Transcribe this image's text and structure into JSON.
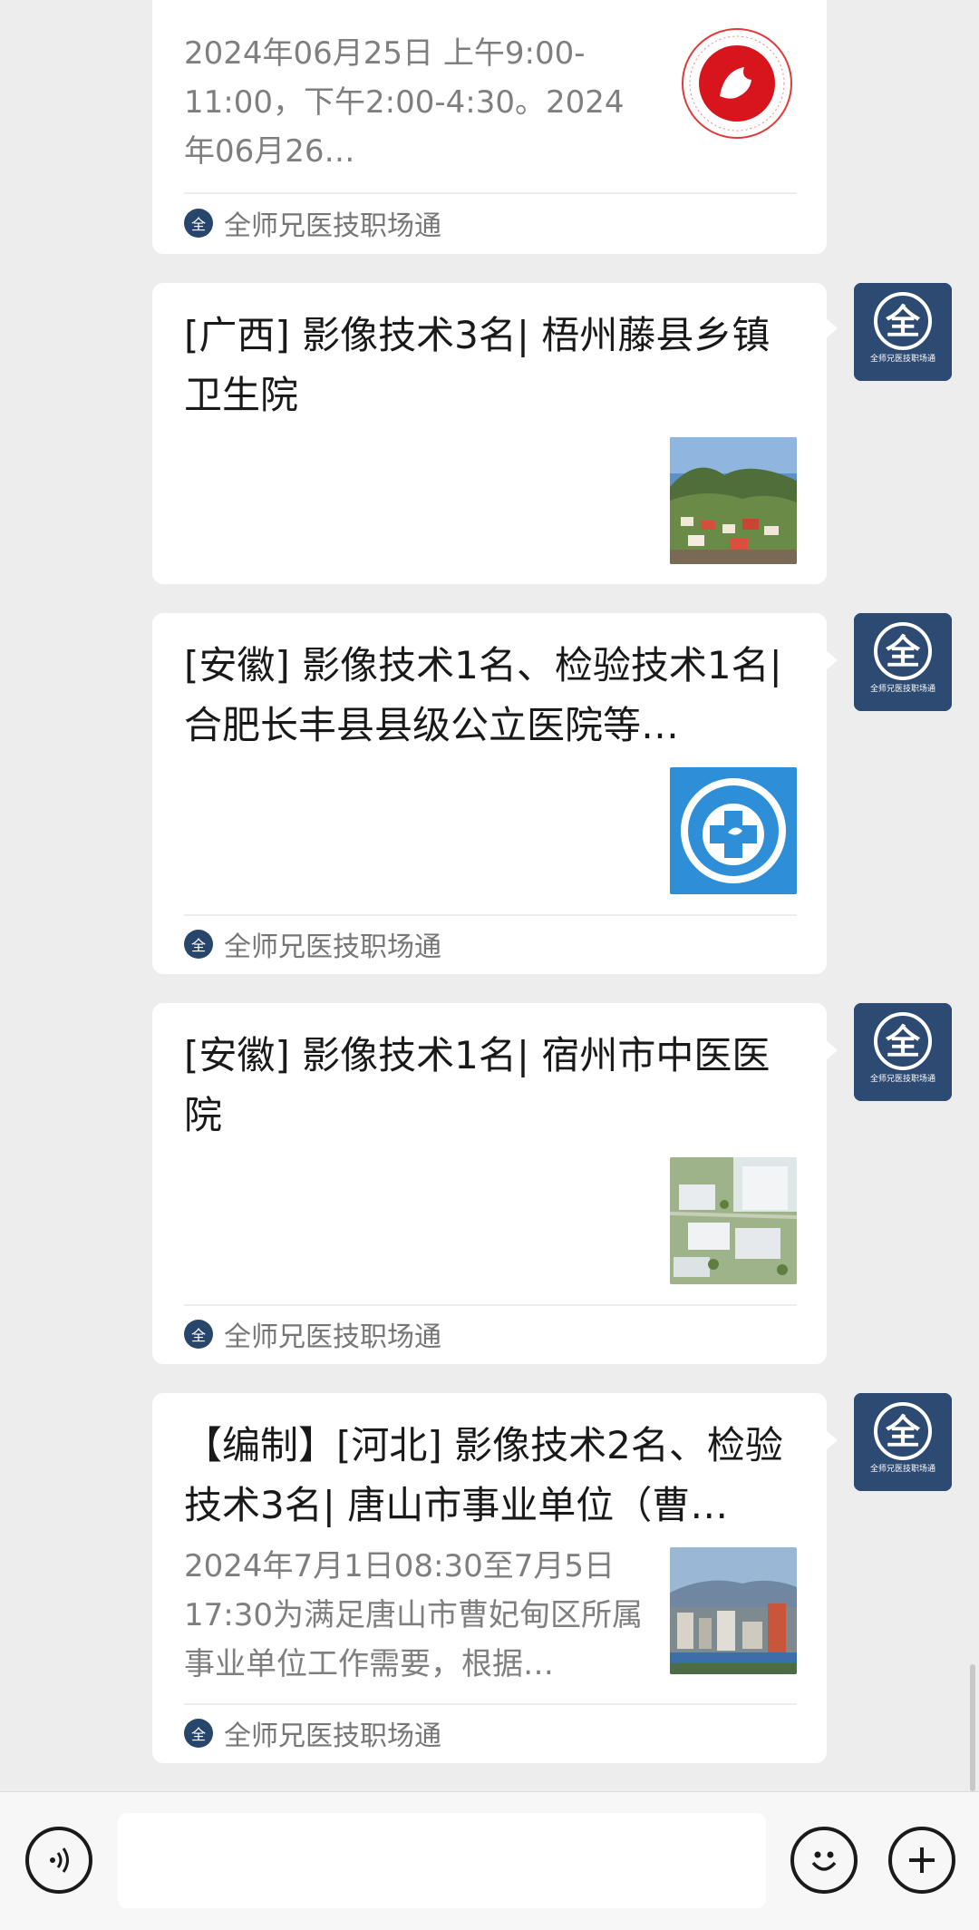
{
  "source_name": "全师兄医技职场通",
  "avatar_glyph": "全",
  "avatar_caption": "全师兄医技职场通",
  "messages": [
    {
      "title": "",
      "description": "2024年06月25日 上午9:00-11:00，下午2:00-4:30。2024年06月26…",
      "source": "全师兄医技职场通"
    },
    {
      "title": "[广西] 影像技术3名| 梧州藤县乡镇卫生院",
      "description": "",
      "source": ""
    },
    {
      "title": "[安徽] 影像技术1名、检验技术1名| 合肥长丰县县级公立医院等…",
      "description": "",
      "source": "全师兄医技职场通"
    },
    {
      "title": "[安徽] 影像技术1名| 宿州市中医医院",
      "description": "",
      "source": "全师兄医技职场通"
    },
    {
      "title": "【编制】[河北] 影像技术2名、检验技术3名| 唐山市事业单位（曹…",
      "description": "2024年7月1日08:30至7月5日17:30为满足唐山市曹妃甸区所属事业单位工作需要，根据…",
      "source": "全师兄医技职场通"
    }
  ],
  "input": {
    "placeholder": ""
  },
  "colors": {
    "background": "#ededed",
    "card": "#ffffff",
    "avatar": "#2c4a72",
    "source_text": "#767676"
  },
  "icons": [
    "voice-icon",
    "emoji-icon",
    "plus-icon"
  ]
}
